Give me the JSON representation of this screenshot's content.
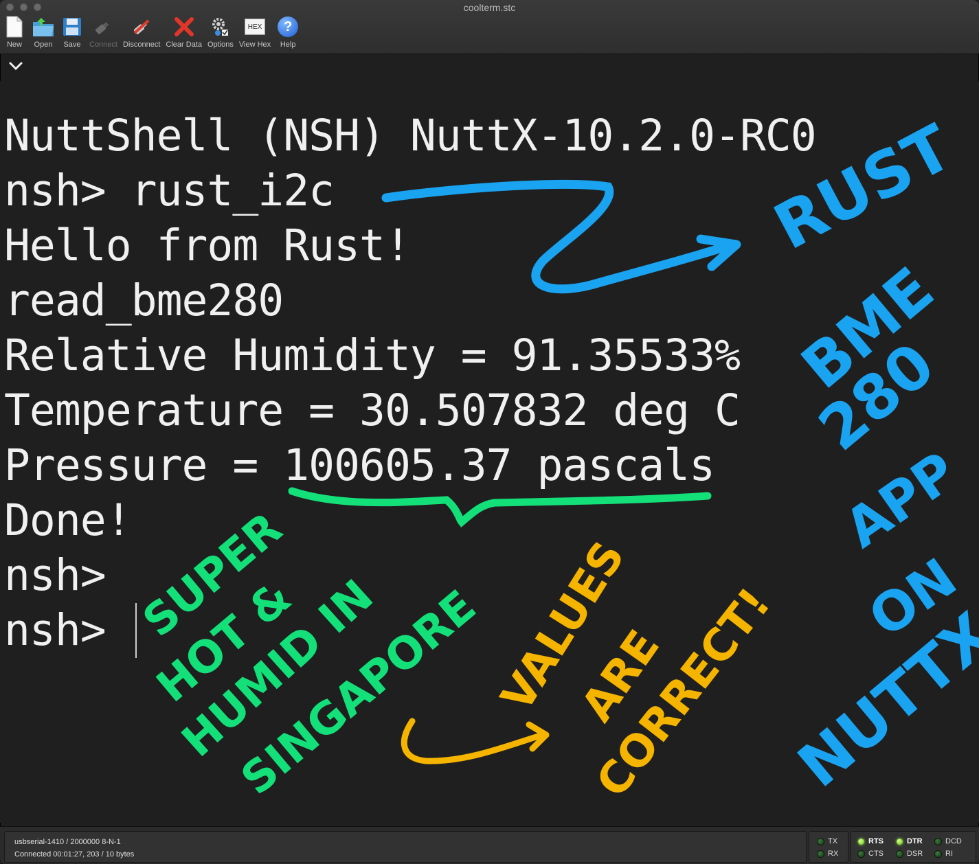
{
  "window": {
    "title": "coolterm.stc"
  },
  "toolbar": {
    "items": [
      {
        "label": "New",
        "icon": "new-document-icon"
      },
      {
        "label": "Open",
        "icon": "open-folder-icon"
      },
      {
        "label": "Save",
        "icon": "save-disk-icon"
      },
      {
        "label": "Connect",
        "icon": "connect-plug-icon",
        "disabled": true
      },
      {
        "label": "Disconnect",
        "icon": "disconnect-plug-icon"
      },
      {
        "label": "Clear Data",
        "icon": "clear-x-icon"
      },
      {
        "label": "Options",
        "icon": "options-gear-icon"
      },
      {
        "label": "View Hex",
        "icon": "hex-icon",
        "icon_text": "HEX"
      },
      {
        "label": "Help",
        "icon": "help-icon",
        "icon_text": "?"
      }
    ]
  },
  "terminal": {
    "lines": [
      "NuttShell (NSH) NuttX-10.2.0-RC0",
      "nsh> rust_i2c",
      "Hello from Rust!",
      "read_bme280",
      "Relative Humidity = 91.35533%",
      "Temperature = 30.507832 deg C",
      "Pressure = 100605.37 pascals",
      "Done!",
      "nsh>",
      "nsh>"
    ]
  },
  "annotations": {
    "rust": "RUST",
    "bme": "BME",
    "n280": "280",
    "app": "APP",
    "on": "ON",
    "nuttx": "NUTTX",
    "super": "SUPER",
    "hot": "HOT &",
    "humid": "HUMID IN",
    "singapore": "SINGAPORE",
    "values": "VALUES",
    "are": "ARE",
    "correct": "CORRECT!",
    "colors": {
      "blue": "#1aa3f0",
      "green": "#14e07a",
      "yellow": "#f5b400"
    }
  },
  "status": {
    "port": "usbserial-1410 / 2000000 8-N-1",
    "connection": "Connected 00:01:27, 203 / 10 bytes",
    "leds": [
      {
        "label": "TX",
        "on": false
      },
      {
        "label": "RX",
        "on": false
      },
      {
        "label": "RTS",
        "on": true
      },
      {
        "label": "CTS",
        "on": false
      },
      {
        "label": "DTR",
        "on": true
      },
      {
        "label": "DSR",
        "on": false
      },
      {
        "label": "DCD",
        "on": false
      },
      {
        "label": "RI",
        "on": false
      }
    ]
  }
}
